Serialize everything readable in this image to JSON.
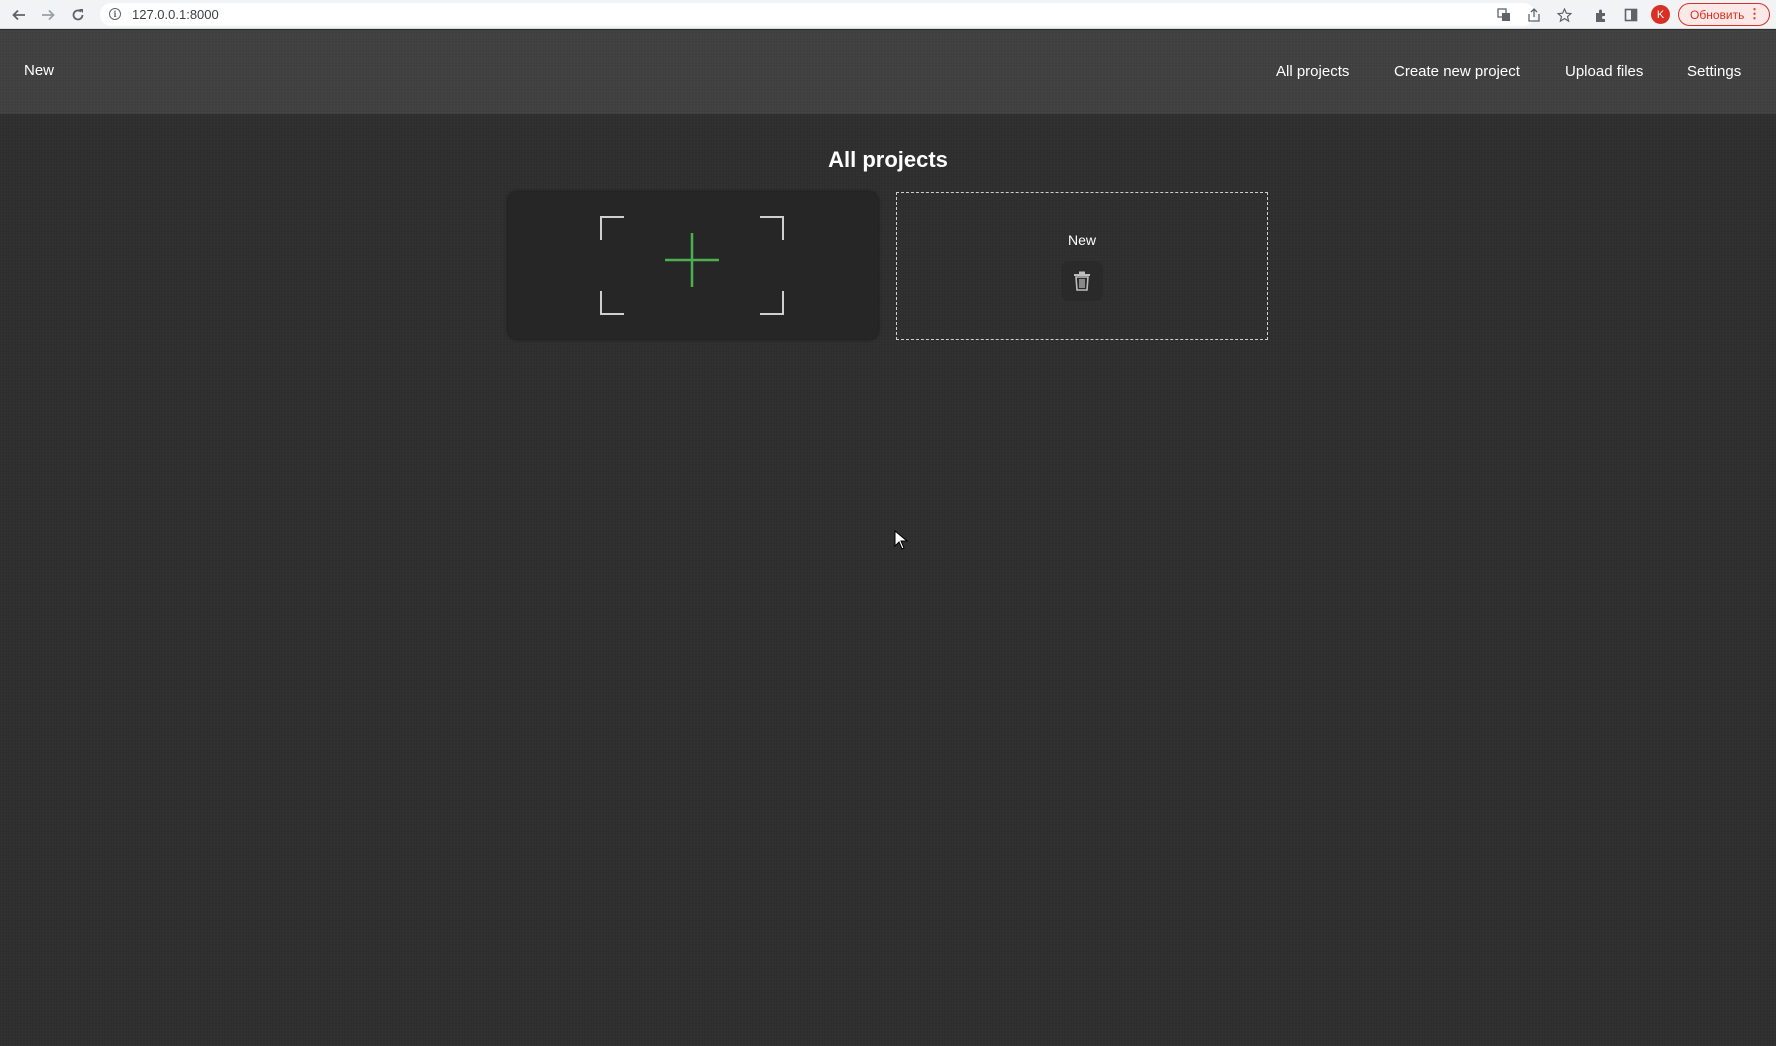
{
  "browser": {
    "url": "127.0.0.1:8000",
    "profile_initial": "K",
    "update_label": "Обновить",
    "accent_color": "#d93025"
  },
  "header": {
    "brand": "New",
    "nav": [
      {
        "label": "All projects"
      },
      {
        "label": "Create new project"
      },
      {
        "label": "Upload files"
      },
      {
        "label": "Settings"
      }
    ]
  },
  "main": {
    "title": "All projects",
    "add_card": {
      "icon": "plus-icon",
      "icon_color": "#4caf50"
    },
    "projects": [
      {
        "name": "New",
        "delete_icon": "trash-icon"
      }
    ]
  }
}
